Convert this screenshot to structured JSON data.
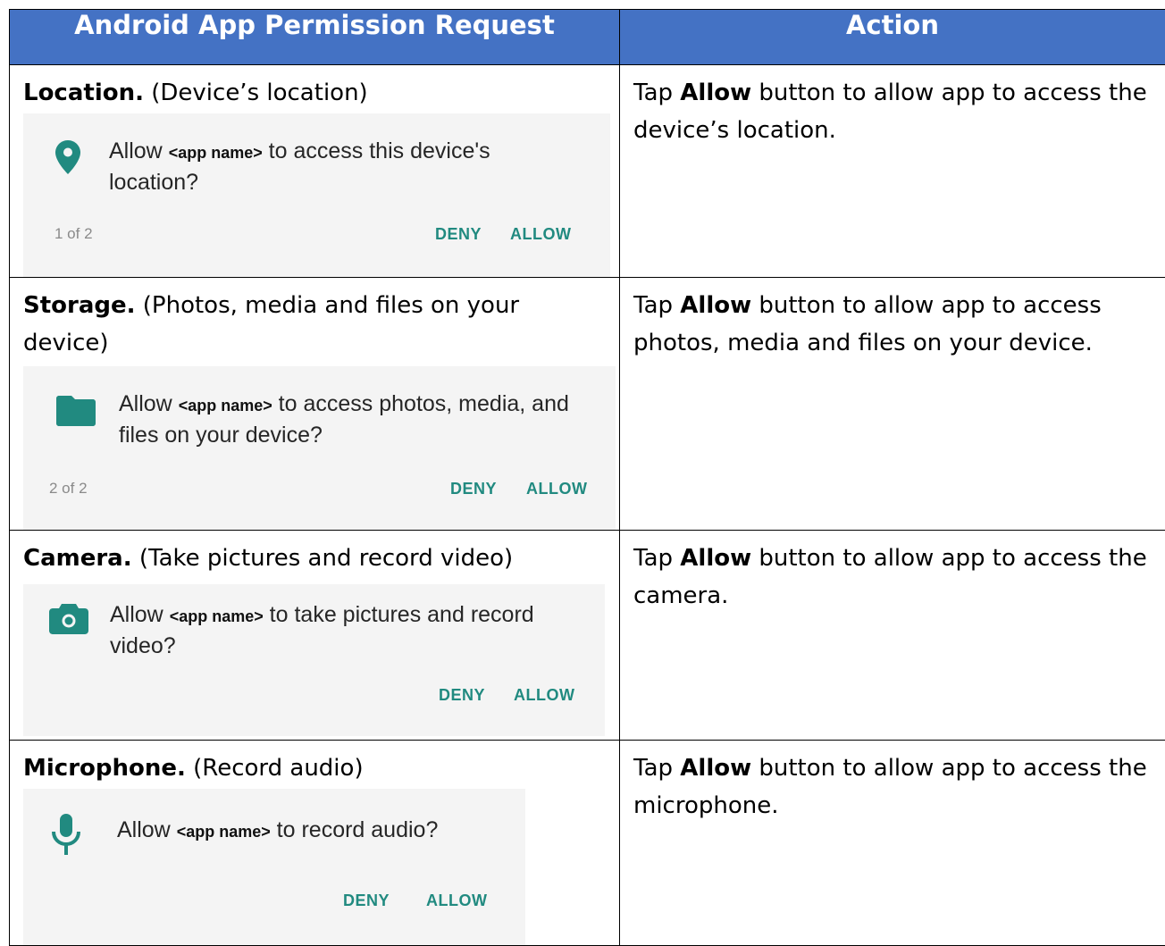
{
  "table": {
    "headers": [
      "Android App Permission Request",
      "Action"
    ],
    "rows": [
      {
        "title_bold": "Location.",
        "title_rest": " (Device’s location)",
        "dialog": {
          "icon": "location-pin-icon",
          "prefix": "Allow ",
          "app_name": "<app name>",
          "suffix": " to access this device's location?",
          "counter": "1 of 2",
          "deny": "DENY",
          "allow": "ALLOW"
        },
        "action_pre": "Tap ",
        "action_bold": "Allow",
        "action_post": " button to allow app to access the device’s location."
      },
      {
        "title_bold": "Storage.",
        "title_rest": " (Photos, media and files on your device)",
        "dialog": {
          "icon": "folder-icon",
          "prefix": "Allow ",
          "app_name": "<app name>",
          "suffix": " to access photos, media, and files on your device?",
          "counter": "2 of 2",
          "deny": "DENY",
          "allow": "ALLOW"
        },
        "action_pre": "Tap ",
        "action_bold": "Allow",
        "action_post": " button to allow app to access photos, media and files on your device."
      },
      {
        "title_bold": "Camera.",
        "title_rest": " (Take pictures and record video)",
        "dialog": {
          "icon": "camera-icon",
          "prefix": "Allow ",
          "app_name": "<app name>",
          "suffix": " to take pictures and record video?",
          "counter": "",
          "deny": "DENY",
          "allow": "ALLOW"
        },
        "action_pre": "Tap ",
        "action_bold": "Allow",
        "action_post": " button to allow app to access the camera."
      },
      {
        "title_bold": "Microphone.",
        "title_rest": " (Record audio)",
        "dialog": {
          "icon": "microphone-icon",
          "prefix": "Allow ",
          "app_name": "<app name>",
          "suffix": " to record audio?",
          "counter": "",
          "deny": "DENY",
          "allow": "ALLOW"
        },
        "action_pre": "Tap ",
        "action_bold": "Allow",
        "action_post": " button to allow app to access the microphone."
      }
    ]
  },
  "colors": {
    "header_bg": "#4472c4",
    "accent": "#218a80",
    "dialog_bg": "#f4f4f4"
  }
}
